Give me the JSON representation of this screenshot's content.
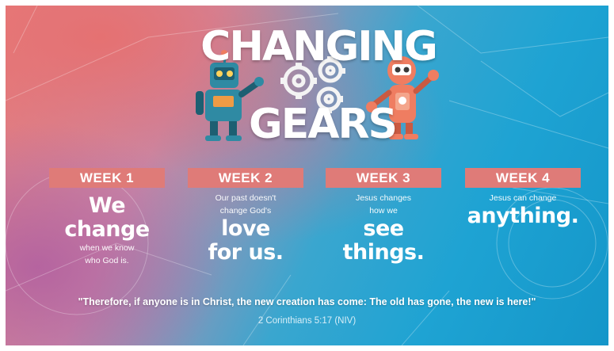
{
  "logo": {
    "title_line1": "CHANGING",
    "title_line2": "GEARS",
    "robot_left_color": "#2f8aa3",
    "robot_right_color": "#ef7d61",
    "gear_color": "#f2f2f2"
  },
  "weeks": [
    {
      "badge": "WEEK 1",
      "pre": "",
      "big1": "We",
      "big2": "change",
      "post1": "when we know",
      "post2": "who God is."
    },
    {
      "badge": "WEEK 2",
      "pre1": "Our past doesn't",
      "pre2": "change God's",
      "big1": "love",
      "big2": "for us."
    },
    {
      "badge": "WEEK 3",
      "pre1": "Jesus changes",
      "pre2": "how we",
      "big1": "see",
      "big2": "things."
    },
    {
      "badge": "WEEK 4",
      "pre1": "Jesus can change",
      "big1": "anything."
    }
  ],
  "verse": {
    "text": "\"Therefore, if anyone is in Christ, the new creation has come: The old has gone, the new is here!\"",
    "reference": "2 Corinthians 5:17 (NIV)"
  },
  "colors": {
    "badge": "#df7b78",
    "coral": "#e77c7b",
    "blue": "#1ea3d3"
  }
}
